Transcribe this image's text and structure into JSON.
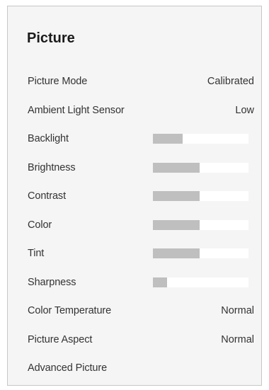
{
  "panel": {
    "title": "Picture"
  },
  "items": [
    {
      "label": "Picture Mode",
      "value": "Calibrated"
    },
    {
      "label": "Ambient Light Sensor",
      "value": "Low"
    },
    {
      "label": "Backlight",
      "level": 0.31
    },
    {
      "label": "Brightness",
      "level": 0.49
    },
    {
      "label": "Contrast",
      "level": 0.49
    },
    {
      "label": "Color",
      "level": 0.49
    },
    {
      "label": "Tint",
      "level": 0.49
    },
    {
      "label": "Sharpness",
      "level": 0.15
    },
    {
      "label": "Color Temperature",
      "value": "Normal"
    },
    {
      "label": "Picture Aspect",
      "value": "Normal"
    },
    {
      "label": "Advanced Picture"
    }
  ],
  "colors": {
    "panel_background": "#f5f5f5",
    "panel_border": "#c7c7c7",
    "slider_track": "#ffffff",
    "slider_fill": "#bfbfbf",
    "text": "#333333"
  }
}
